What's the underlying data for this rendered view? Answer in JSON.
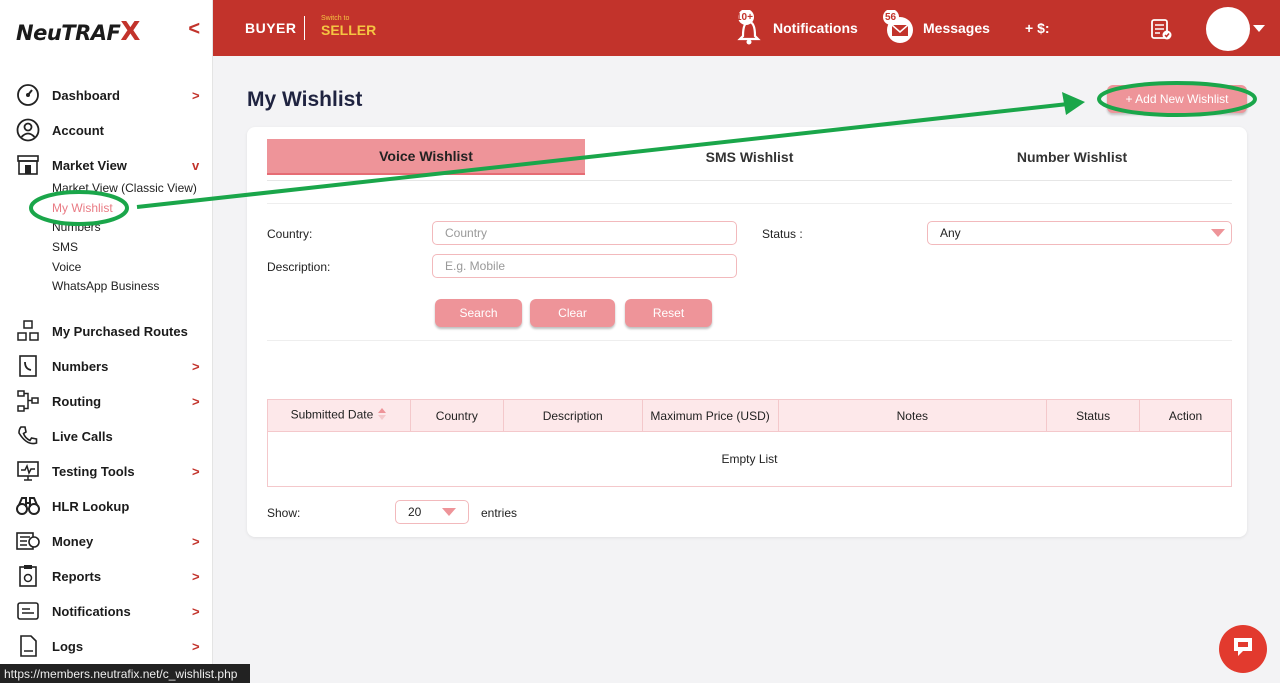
{
  "brand": {
    "logo_text": "NeuTRAF",
    "logo_x": "X",
    "collapse_glyph": "<"
  },
  "sidebar": {
    "items": [
      {
        "label": "Dashboard",
        "icon": "speedometer-icon",
        "chevron": ">"
      },
      {
        "label": "Account",
        "icon": "user-icon",
        "chevron": ""
      },
      {
        "label": "Market View",
        "icon": "storefront-icon",
        "chevron": "v"
      },
      {
        "label": "My Purchased Routes",
        "icon": "boxes-icon",
        "chevron": ""
      },
      {
        "label": "Numbers",
        "icon": "phone-book-icon",
        "chevron": ">"
      },
      {
        "label": "Routing",
        "icon": "network-icon",
        "chevron": ">"
      },
      {
        "label": "Live Calls",
        "icon": "phone-call-icon",
        "chevron": ""
      },
      {
        "label": "Testing Tools",
        "icon": "monitor-icon",
        "chevron": ">"
      },
      {
        "label": "HLR Lookup",
        "icon": "binoculars-icon",
        "chevron": ""
      },
      {
        "label": "Money",
        "icon": "money-icon",
        "chevron": ">"
      },
      {
        "label": "Reports",
        "icon": "report-icon",
        "chevron": ">"
      },
      {
        "label": "Notifications",
        "icon": "bell-icon",
        "chevron": ">"
      },
      {
        "label": "Logs",
        "icon": "logs-icon",
        "chevron": ">"
      }
    ],
    "market_sub": [
      "Market View (Classic View)",
      "My Wishlist",
      "Numbers",
      "SMS",
      "Voice",
      "WhatsApp Business"
    ]
  },
  "header": {
    "buyer": "BUYER",
    "switch_small": "Switch to",
    "seller": "SELLER",
    "notif_badge": "10+",
    "notif_label": "Notifications",
    "msg_badge": "56",
    "msg_label": "Messages",
    "balance": "+ $:"
  },
  "page": {
    "title": "My Wishlist",
    "add_button": "+ Add New Wishlist"
  },
  "tabs": [
    "Voice Wishlist",
    "SMS Wishlist",
    "Number Wishlist"
  ],
  "filters": {
    "country_label": "Country:",
    "country_placeholder": "Country",
    "status_label": "Status :",
    "status_value": "Any",
    "description_label": "Description:",
    "description_placeholder": "E.g. Mobile",
    "search": "Search",
    "clear": "Clear",
    "reset": "Reset"
  },
  "table": {
    "columns": [
      "Submitted Date",
      "Country",
      "Description",
      "Maximum Price (USD)",
      "Notes",
      "Status",
      "Action"
    ],
    "empty": "Empty List"
  },
  "footer": {
    "show_label": "Show:",
    "show_value": "20",
    "entries": "entries"
  },
  "status_url": "https://members.neutrafix.net/c_wishlist.php",
  "colors": {
    "brand_red": "#c2332b",
    "pink": "#ee9499",
    "annotation_green": "#1aa64a"
  }
}
